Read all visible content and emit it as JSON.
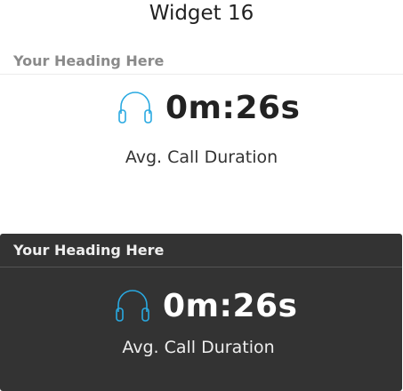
{
  "page": {
    "title": "Widget 16"
  },
  "widgets": [
    {
      "theme": "light",
      "heading": "Your Heading Here",
      "icon": "headphones-icon",
      "value": "0m:26s",
      "label": "Avg. Call Duration",
      "accent_color": "#29a9e1"
    },
    {
      "theme": "dark",
      "heading": "Your Heading Here",
      "icon": "headphones-icon",
      "value": "0m:26s",
      "label": "Avg. Call Duration",
      "accent_color": "#29a9e1"
    }
  ]
}
